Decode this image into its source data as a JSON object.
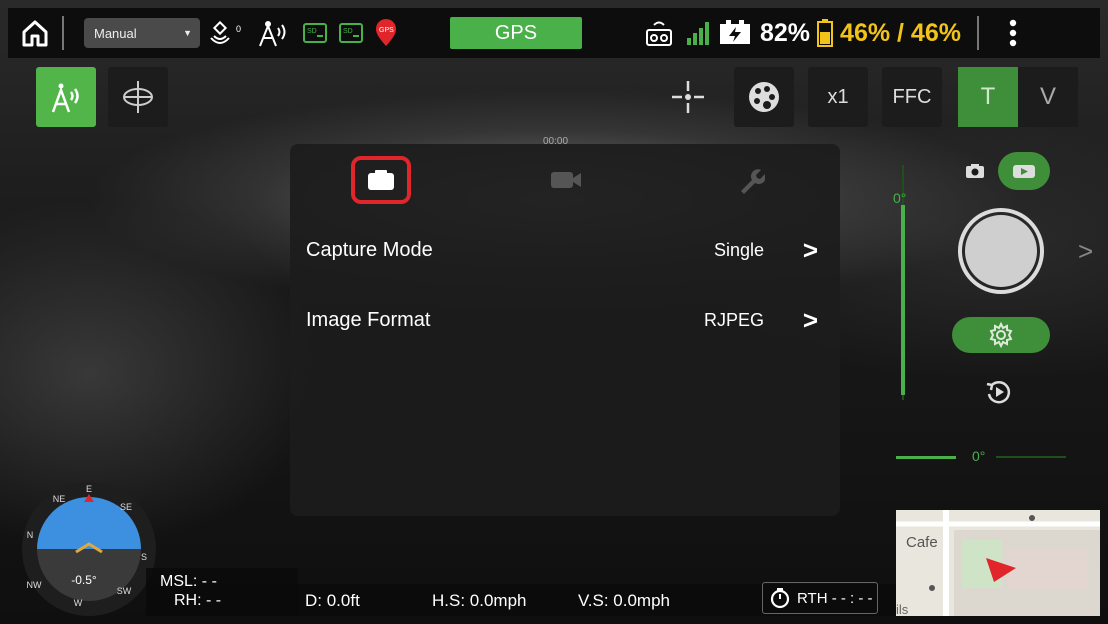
{
  "topbar": {
    "mode": "Manual",
    "gps_label": "GPS",
    "signal_battery": "82%",
    "drone_battery": "46% / 46%"
  },
  "camera_controls": {
    "zoom_label": "x1",
    "ffc_label": "FFC",
    "t_label": "T",
    "v_label": "V",
    "timer": "00:00"
  },
  "panel": {
    "rows": [
      {
        "label": "Capture Mode",
        "value": "Single"
      },
      {
        "label": "Image Format",
        "value": "RJPEG"
      }
    ]
  },
  "gimbal": {
    "pitch_label": "0°",
    "yaw_label": "0°"
  },
  "telemetry": {
    "msl": "MSL:  - -",
    "rh": "RH:  - -",
    "distance": "D: 0.0ft",
    "hspeed": "H.S: 0.0mph",
    "vspeed": "V.S: 0.0mph",
    "rth": "RTH  - - : - -",
    "attitude_roll": "-0.5°"
  },
  "compass": {
    "labels": [
      "N",
      "NE",
      "E",
      "SE",
      "S",
      "SW",
      "W",
      "NW"
    ]
  },
  "map": {
    "cafe_label": "Cafe",
    "ils_label": "ils"
  },
  "colors": {
    "accent_green": "#49b04a",
    "active_tab_red": "#e0262b",
    "battery_yellow": "#f2c318"
  }
}
